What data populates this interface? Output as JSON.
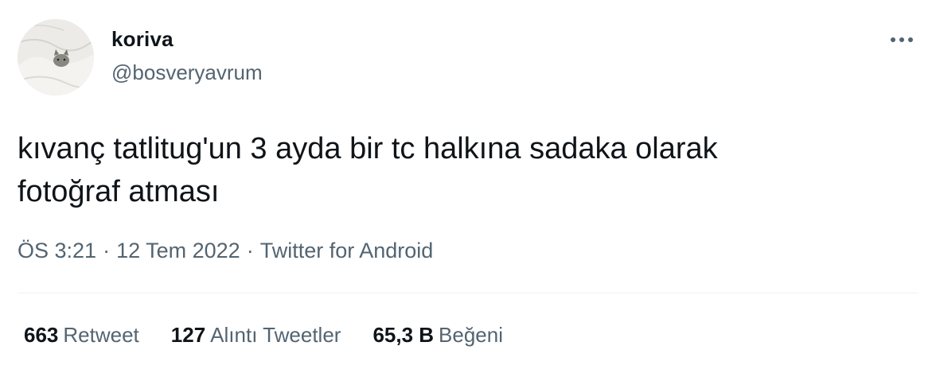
{
  "user": {
    "display_name": "koriva",
    "handle": "@bosveryavrum",
    "avatar_icon": "cat-on-bed-avatar"
  },
  "menu_icon": "more-horizontal-icon",
  "tweet": {
    "text": "kıvanç tatlitug'un 3 ayda bir tc halkına sadaka olarak\nfotoğraf atması"
  },
  "meta": {
    "time": "ÖS 3:21",
    "separator": "·",
    "date": "12 Tem 2022",
    "source": "Twitter for Android"
  },
  "stats": {
    "retweets": {
      "count": "663",
      "label": "Retweet"
    },
    "quotes": {
      "count": "127",
      "label": "Alıntı Tweetler"
    },
    "likes": {
      "count": "65,3 B",
      "label": "Beğeni"
    }
  },
  "colors": {
    "primary_text": "#0f1419",
    "secondary_text": "#536471",
    "divider": "#eff3f4"
  }
}
